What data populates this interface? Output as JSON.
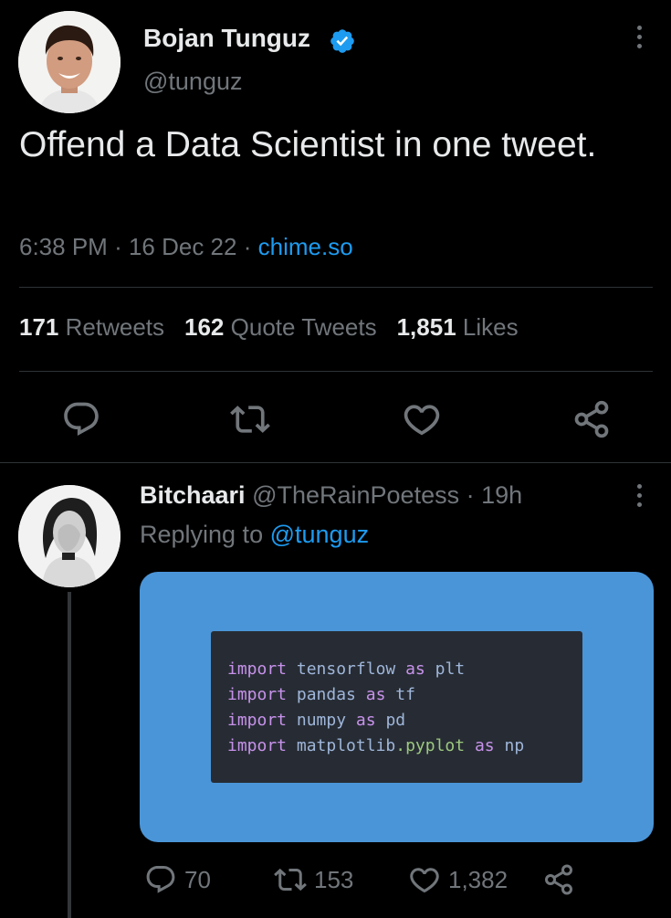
{
  "tweet": {
    "author_name": "Bojan Tunguz",
    "author_handle": "@tunguz",
    "text": "Offend a Data Scientist in one tweet.",
    "time": "6:38 PM",
    "date": "16 Dec 22",
    "source": "chime.so",
    "retweets_count": "171",
    "retweets_label": "Retweets",
    "quotes_count": "162",
    "quotes_label": "Quote Tweets",
    "likes_count": "1,851",
    "likes_label": "Likes"
  },
  "reply": {
    "author_name": "Bitchaari",
    "author_handle": "@TheRainPoetess",
    "age": "19h",
    "replying_label": "Replying to",
    "replying_handle": "@tunguz",
    "code_lines": [
      {
        "kw": "import",
        "mod": "tensorflow",
        "as": "as",
        "alias": "plt"
      },
      {
        "kw": "import",
        "mod": "pandas",
        "as": "as",
        "alias": "tf"
      },
      {
        "kw": "import",
        "mod": "numpy",
        "as": "as",
        "alias": "pd"
      },
      {
        "kw": "import",
        "mod": "matplotlib",
        "mod2": ".pyplot",
        "as": "as",
        "alias": "np"
      }
    ],
    "reply_count": "70",
    "retweet_count": "153",
    "like_count": "1,382"
  },
  "icons": {
    "verified": "verified-badge-icon",
    "more": "more-dots-icon",
    "reply": "reply-bubble-icon",
    "retweet": "retweet-icon",
    "like": "heart-icon",
    "share": "share-icon"
  },
  "colors": {
    "background": "#000000",
    "accent": "#1d9bf0",
    "muted": "#71767b",
    "media_background": "#4a95d8",
    "code_background": "#272c34"
  }
}
